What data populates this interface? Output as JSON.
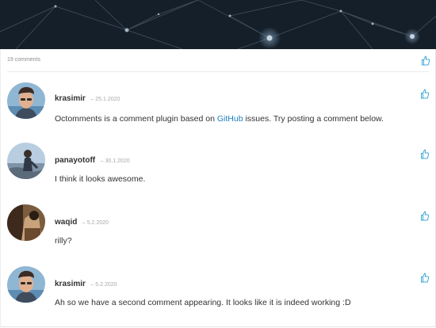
{
  "header": {
    "comment_count": "19 comments"
  },
  "comments": [
    {
      "author": "krasimir",
      "date": "25.1.2020",
      "body_before": "Octomments is a comment plugin based on ",
      "link_text": "GitHub",
      "body_after": " issues. Try posting a comment below."
    },
    {
      "author": "panayotoff",
      "date": "30.1.2020",
      "body": "I think it looks awesome."
    },
    {
      "author": "waqid",
      "date": "5.2.2020",
      "body": "rilly?"
    },
    {
      "author": "krasimir",
      "date": "5.2.2020",
      "body": "Ah so we have a second comment appearing. It looks like it is indeed working :D"
    }
  ],
  "icons": {
    "like": "thumbs-up-icon",
    "avatar": "avatar"
  },
  "colors": {
    "link": "#1b7fbf",
    "like_icon": "#3fa7d6",
    "hero_bg": "#121a24"
  }
}
